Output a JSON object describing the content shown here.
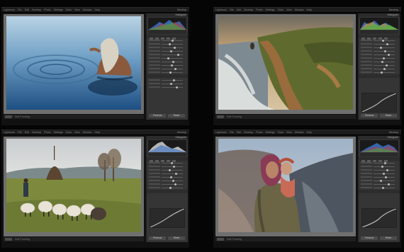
{
  "app": {
    "menu_items": [
      "Lightroom",
      "File",
      "Edit",
      "Develop",
      "Photo",
      "Settings",
      "Tools",
      "View",
      "Window",
      "Help"
    ],
    "module": "Develop",
    "panel_title": "Histogram",
    "filmstrip_label": "Soft Proofing",
    "buttons": {
      "previous": "Previous",
      "reset": "Reset"
    }
  },
  "photos": [
    {
      "subject": "man-bathing-in-lake"
    },
    {
      "subject": "coastal-cliffs"
    },
    {
      "subject": "shepherd-with-sheep"
    },
    {
      "subject": "woman-carrying-child"
    }
  ],
  "colors": {
    "background": "#050505",
    "viewport_gray": "#6f6f6f",
    "panel": "#353535"
  }
}
